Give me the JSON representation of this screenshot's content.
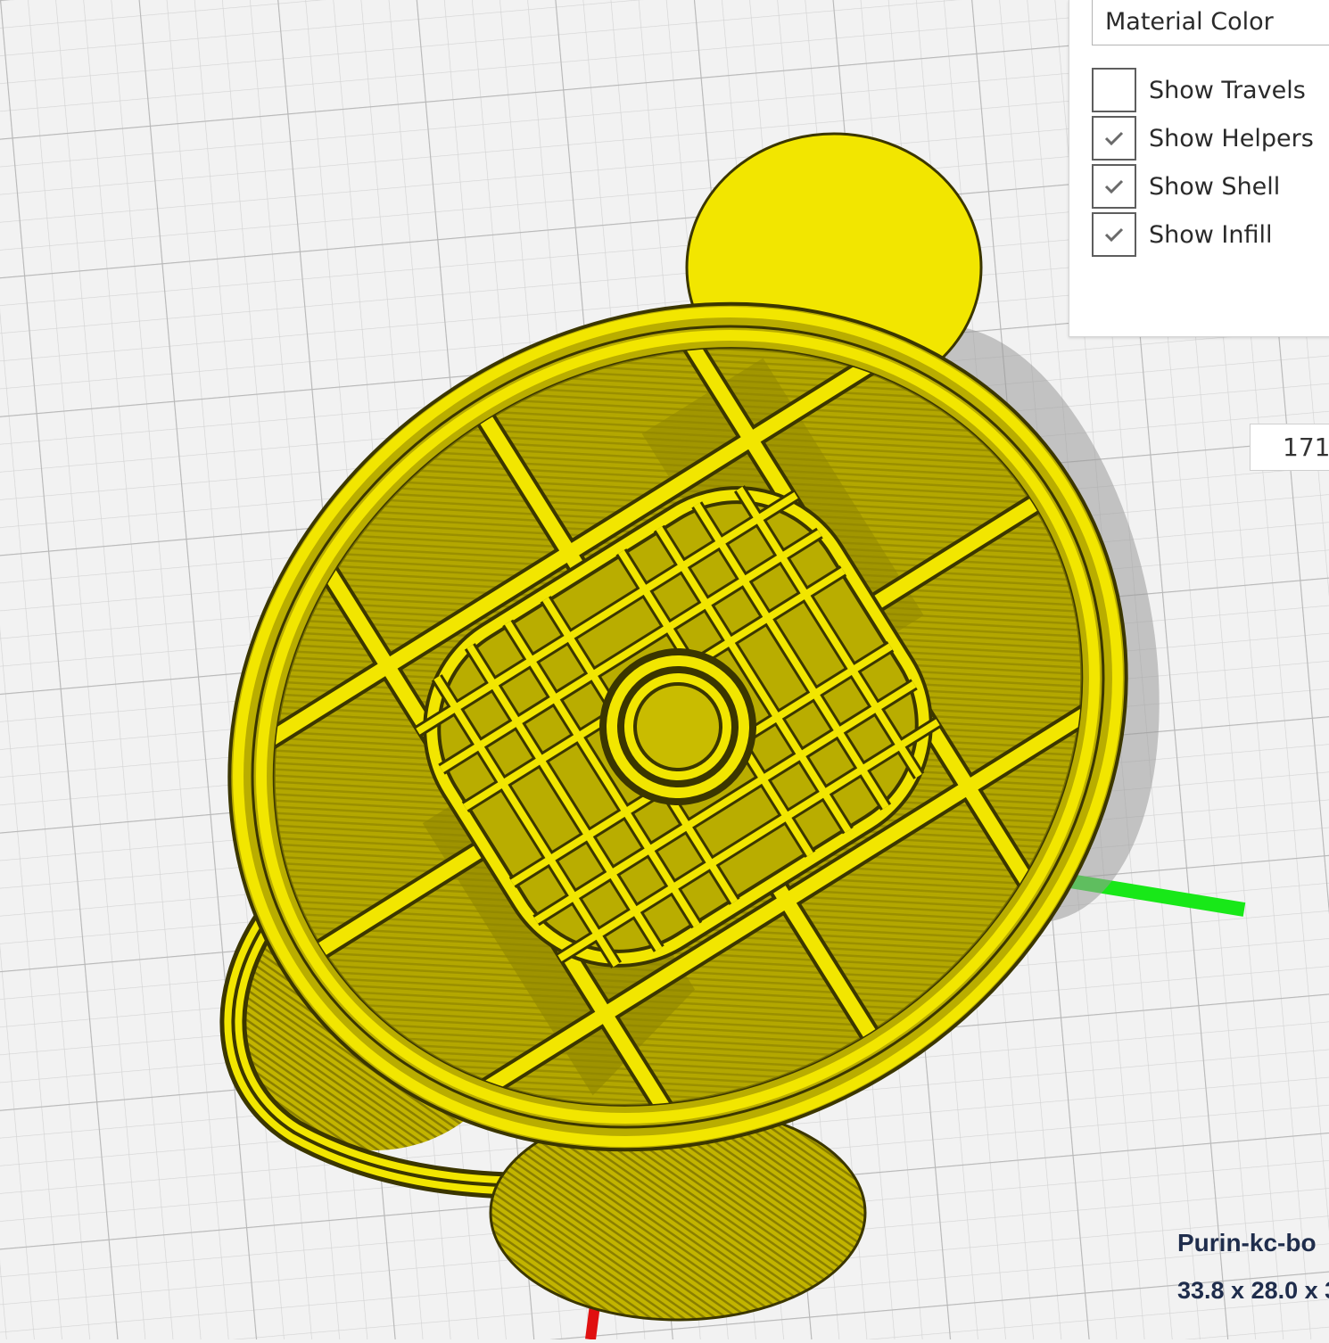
{
  "view_panel": {
    "color_scheme": "Material Color",
    "options": [
      {
        "label": "Show Travels",
        "checked": false
      },
      {
        "label": "Show Helpers",
        "checked": true
      },
      {
        "label": "Show Shell",
        "checked": true
      },
      {
        "label": "Show Infill",
        "checked": true
      }
    ]
  },
  "layer_slider": {
    "value": "171"
  },
  "object_info": {
    "name": "Purin-kc-bo",
    "dimensions": "33.8 x 28.0 x 3"
  },
  "colors": {
    "filament": "#f2e600",
    "axis_x": "#e01010",
    "axis_y": "#18e818",
    "build_plate": "#f2f2f2"
  }
}
